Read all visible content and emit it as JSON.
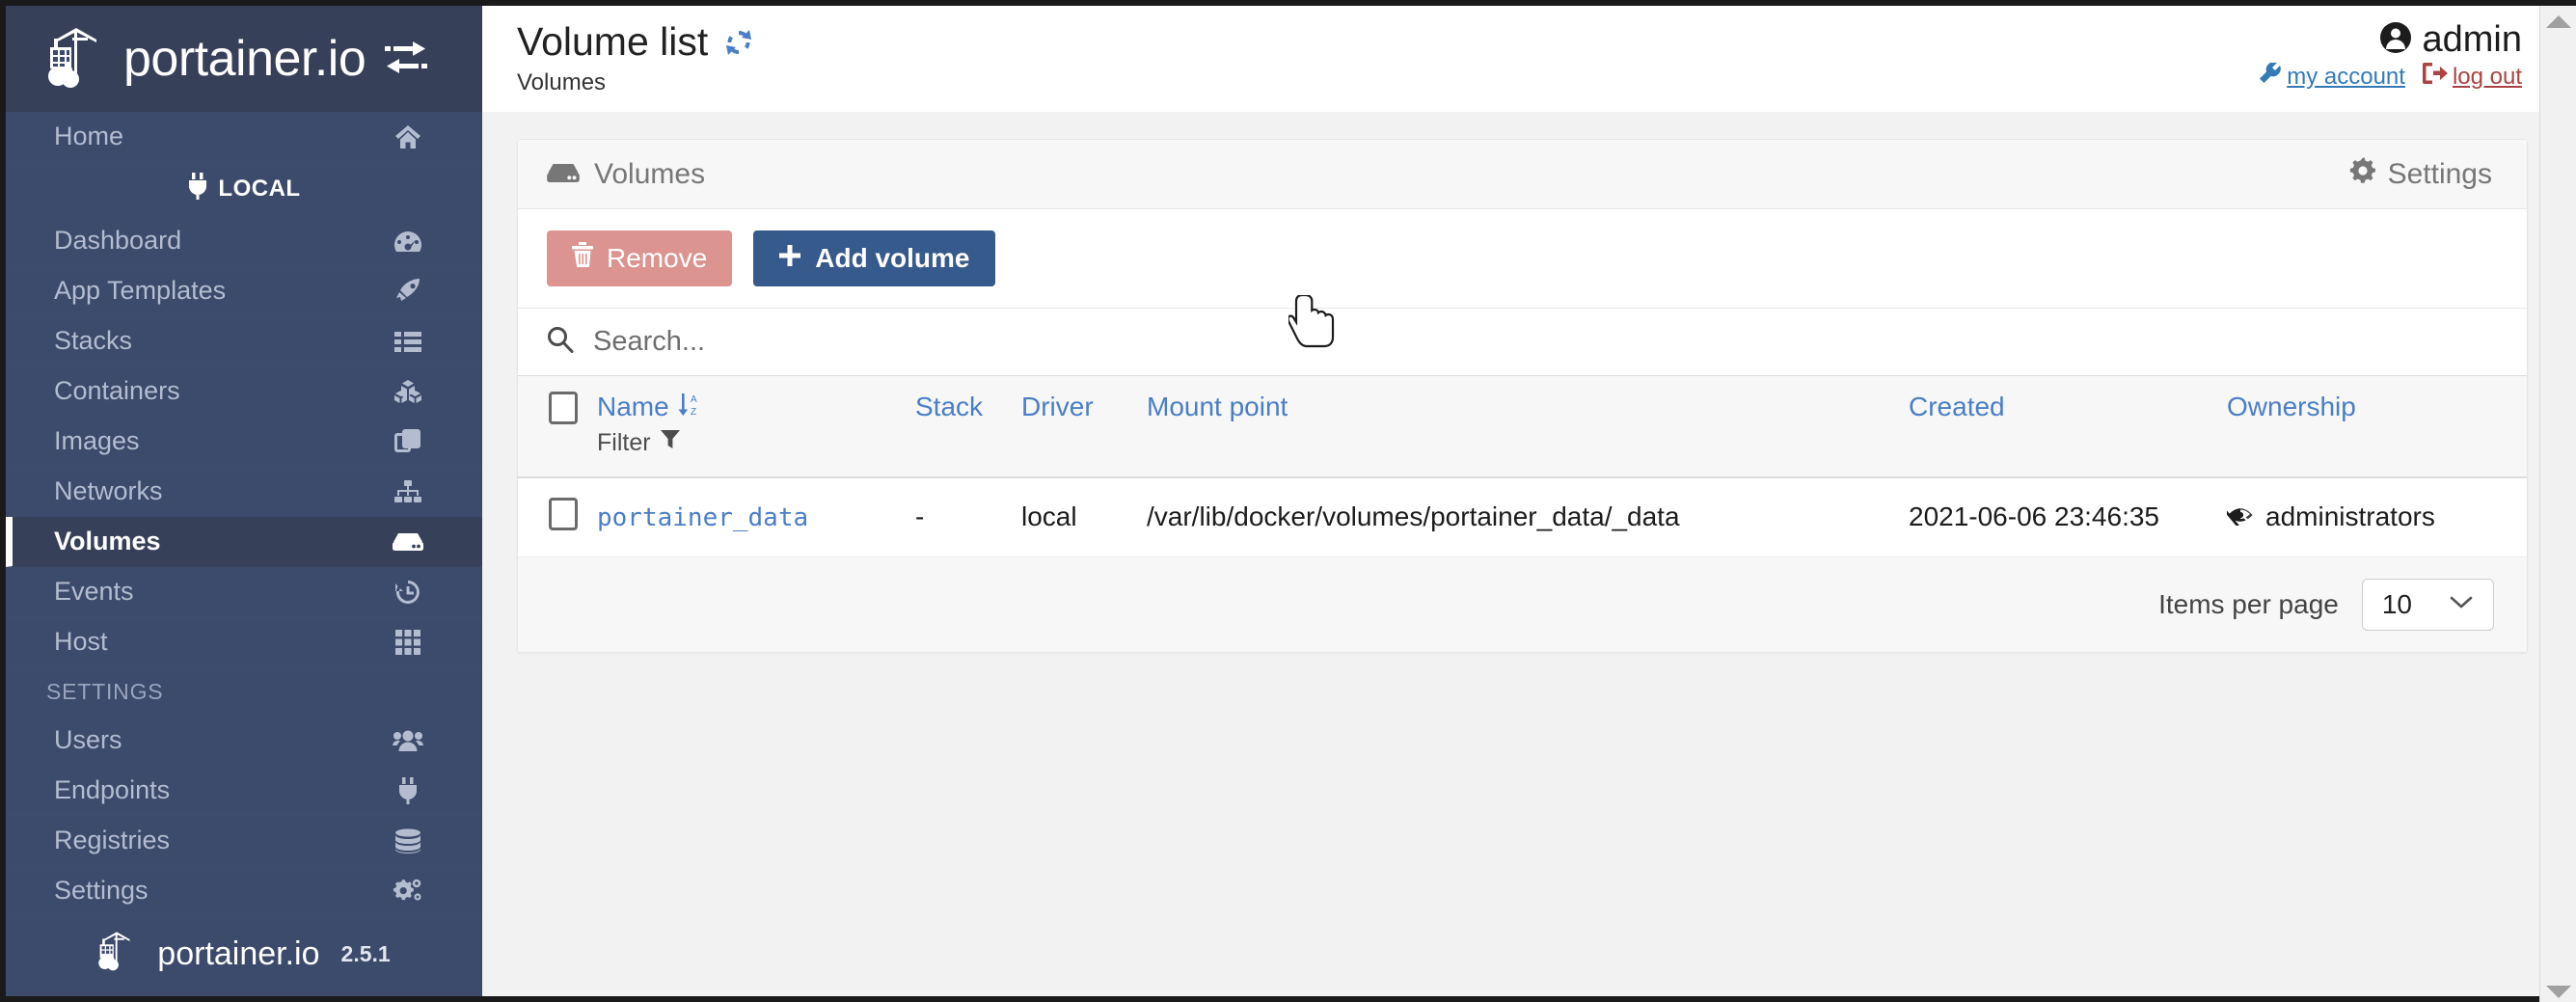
{
  "brand": {
    "name": "portainer.io",
    "toggle_icon": "exchange-toggle-icon"
  },
  "sidebar": {
    "items": [
      {
        "label": "Home",
        "icon": "home-icon",
        "active": false,
        "type": "item"
      },
      {
        "label": "LOCAL",
        "icon": "plug-icon",
        "active": false,
        "type": "endpoint"
      },
      {
        "label": "Dashboard",
        "icon": "tachometer-icon",
        "active": false,
        "type": "item"
      },
      {
        "label": "App Templates",
        "icon": "rocket-icon",
        "active": false,
        "type": "item"
      },
      {
        "label": "Stacks",
        "icon": "list-icon",
        "active": false,
        "type": "item"
      },
      {
        "label": "Containers",
        "icon": "cubes-icon",
        "active": false,
        "type": "item"
      },
      {
        "label": "Images",
        "icon": "clone-icon",
        "active": false,
        "type": "item"
      },
      {
        "label": "Networks",
        "icon": "sitemap-icon",
        "active": false,
        "type": "item"
      },
      {
        "label": "Volumes",
        "icon": "hdd-icon",
        "active": true,
        "type": "item"
      },
      {
        "label": "Events",
        "icon": "history-icon",
        "active": false,
        "type": "item"
      },
      {
        "label": "Host",
        "icon": "th-grid-icon",
        "active": false,
        "type": "item"
      },
      {
        "label": "SETTINGS",
        "icon": "",
        "active": false,
        "type": "section"
      },
      {
        "label": "Users",
        "icon": "users-icon",
        "active": false,
        "type": "item"
      },
      {
        "label": "Endpoints",
        "icon": "plug-icon",
        "active": false,
        "type": "item"
      },
      {
        "label": "Registries",
        "icon": "database-icon",
        "active": false,
        "type": "item"
      },
      {
        "label": "Settings",
        "icon": "cogs-icon",
        "active": false,
        "type": "item"
      }
    ],
    "footer": {
      "brand": "portainer.io",
      "version": "2.5.1"
    }
  },
  "topbar": {
    "title": "Volume list",
    "refresh_icon": "refresh-sync-icon",
    "breadcrumb": "Volumes",
    "user": {
      "name": "admin",
      "avatar_icon": "user-circle-icon",
      "account_link": "my account",
      "account_icon": "wrench-icon",
      "logout_link": "log out",
      "logout_icon": "sign-out-icon"
    }
  },
  "panel": {
    "title": "Volumes",
    "title_icon": "hdd-icon",
    "settings_label": "Settings",
    "settings_icon": "gear-icon",
    "buttons": {
      "remove": {
        "label": "Remove",
        "icon": "trash-icon"
      },
      "add": {
        "label": "Add volume",
        "icon": "plus-icon"
      }
    },
    "search": {
      "placeholder": "Search...",
      "value": "",
      "icon": "search-icon"
    },
    "table": {
      "columns": [
        {
          "key": "check",
          "label": ""
        },
        {
          "key": "name",
          "label": "Name",
          "sort_icon": "sort-alpha-down-icon"
        },
        {
          "key": "stack",
          "label": "Stack"
        },
        {
          "key": "driver",
          "label": "Driver"
        },
        {
          "key": "mount",
          "label": "Mount point"
        },
        {
          "key": "created",
          "label": "Created"
        },
        {
          "key": "ownership",
          "label": "Ownership"
        }
      ],
      "filter_label": "Filter",
      "filter_icon": "funnel-icon",
      "rows": [
        {
          "name": "portainer_data",
          "stack": "-",
          "driver": "local",
          "mount": "/var/lib/docker/volumes/portainer_data/_data",
          "created": "2021-06-06 23:46:35",
          "ownership": "administrators",
          "ownership_icon": "eye-slash-icon",
          "selected": false
        }
      ]
    },
    "pagination": {
      "items_per_page_label": "Items per page",
      "items_per_page_value": "10",
      "chevron_icon": "chevron-down-icon"
    }
  },
  "colors": {
    "sidebar_bg": "#3c4a6b",
    "sidebar_active_bg": "#364059",
    "link_blue": "#4a7ec7",
    "btn_primary": "#375a8c",
    "btn_danger": "#dc9490",
    "logout_red": "#a94442"
  }
}
